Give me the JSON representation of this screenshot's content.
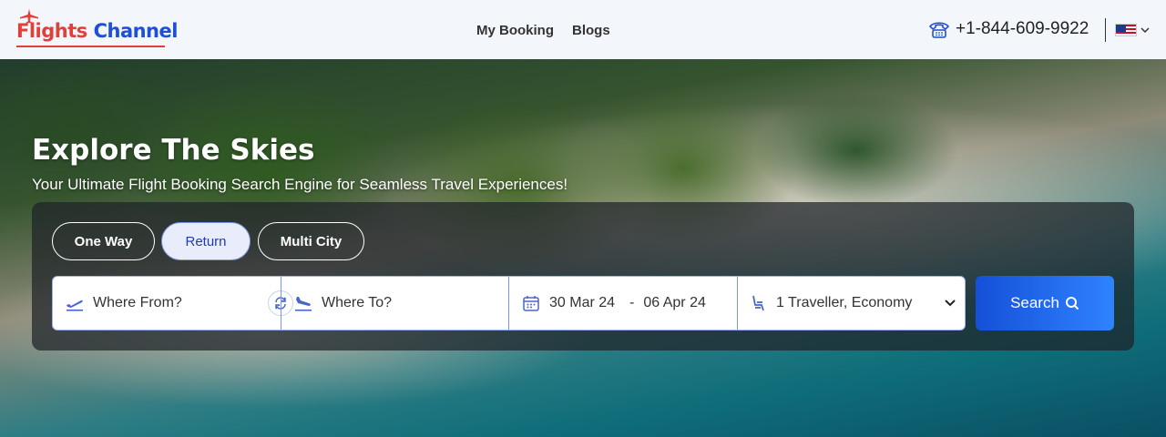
{
  "brand": {
    "name_part1": "Flights",
    "name_part2": "Channel"
  },
  "nav": {
    "items": [
      "My Booking",
      "Blogs"
    ]
  },
  "header": {
    "phone": "+1-844-609-9922"
  },
  "hero": {
    "title": "Explore The Skies",
    "subtitle": "Your Ultimate Flight Booking Search Engine for Seamless Travel Experiences!"
  },
  "trip_types": {
    "options": [
      "One Way",
      "Return",
      "Multi City"
    ],
    "selected": "Return"
  },
  "search": {
    "from_placeholder": "Where From?",
    "to_placeholder": "Where To?",
    "depart_date": "30 Mar 24",
    "date_separator": "-",
    "return_date": "06 Apr 24",
    "travellers": "1 Traveller, Economy",
    "button_label": "Search"
  },
  "colors": {
    "accent": "#1d4fd8",
    "brand_red": "#e0403a",
    "button_start": "#1550d8",
    "button_end": "#2f83ff"
  },
  "icons": [
    "plane-icon",
    "phone-icon",
    "us-flag-icon",
    "chevron-down-icon",
    "takeoff-icon",
    "swap-icon",
    "landing-icon",
    "calendar-icon",
    "seat-icon",
    "search-icon"
  ]
}
